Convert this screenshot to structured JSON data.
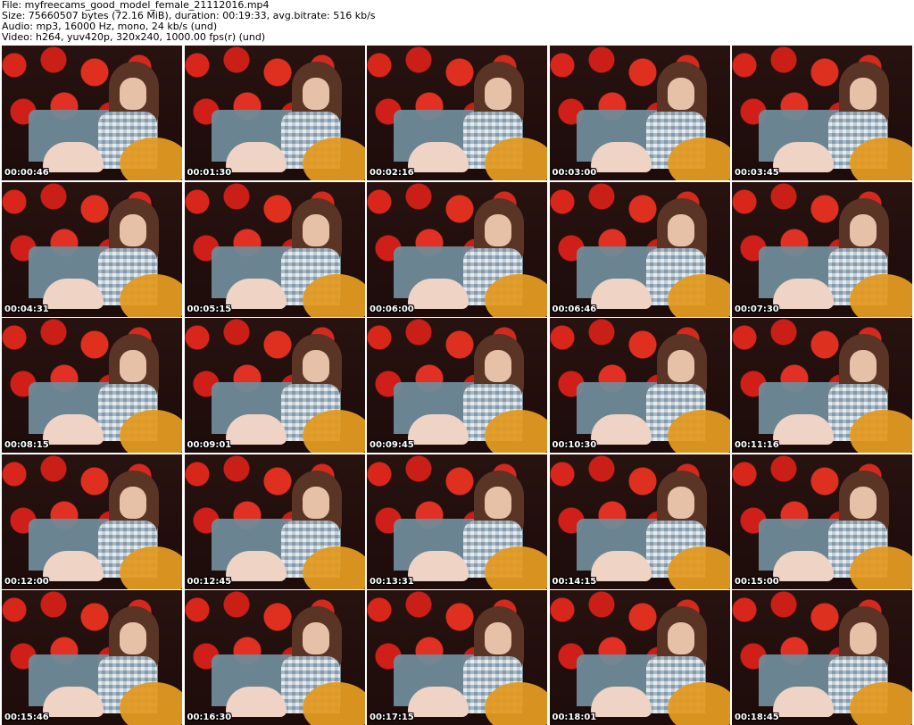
{
  "header": {
    "file": "File: myfreecams_good_model_female_21112016.mp4",
    "size": "Size: 75660507 bytes (72.16 MiB), duration: 00:19:33, avg.bitrate: 516 kb/s",
    "audio": "Audio: mp3, 16000 Hz, mono, 24 kb/s (und)",
    "video": "Video: h264, yuv420p, 320x240, 1000.00 fps(r) (und)"
  },
  "thumbnails": [
    "00:00:46",
    "00:01:30",
    "00:02:16",
    "00:03:00",
    "00:03:45",
    "00:04:31",
    "00:05:15",
    "00:06:00",
    "00:06:46",
    "00:07:30",
    "00:08:15",
    "00:09:01",
    "00:09:45",
    "00:10:30",
    "00:11:16",
    "00:12:00",
    "00:12:45",
    "00:13:31",
    "00:14:15",
    "00:15:00",
    "00:15:46",
    "00:16:30",
    "00:17:15",
    "00:18:01",
    "00:18:45"
  ]
}
